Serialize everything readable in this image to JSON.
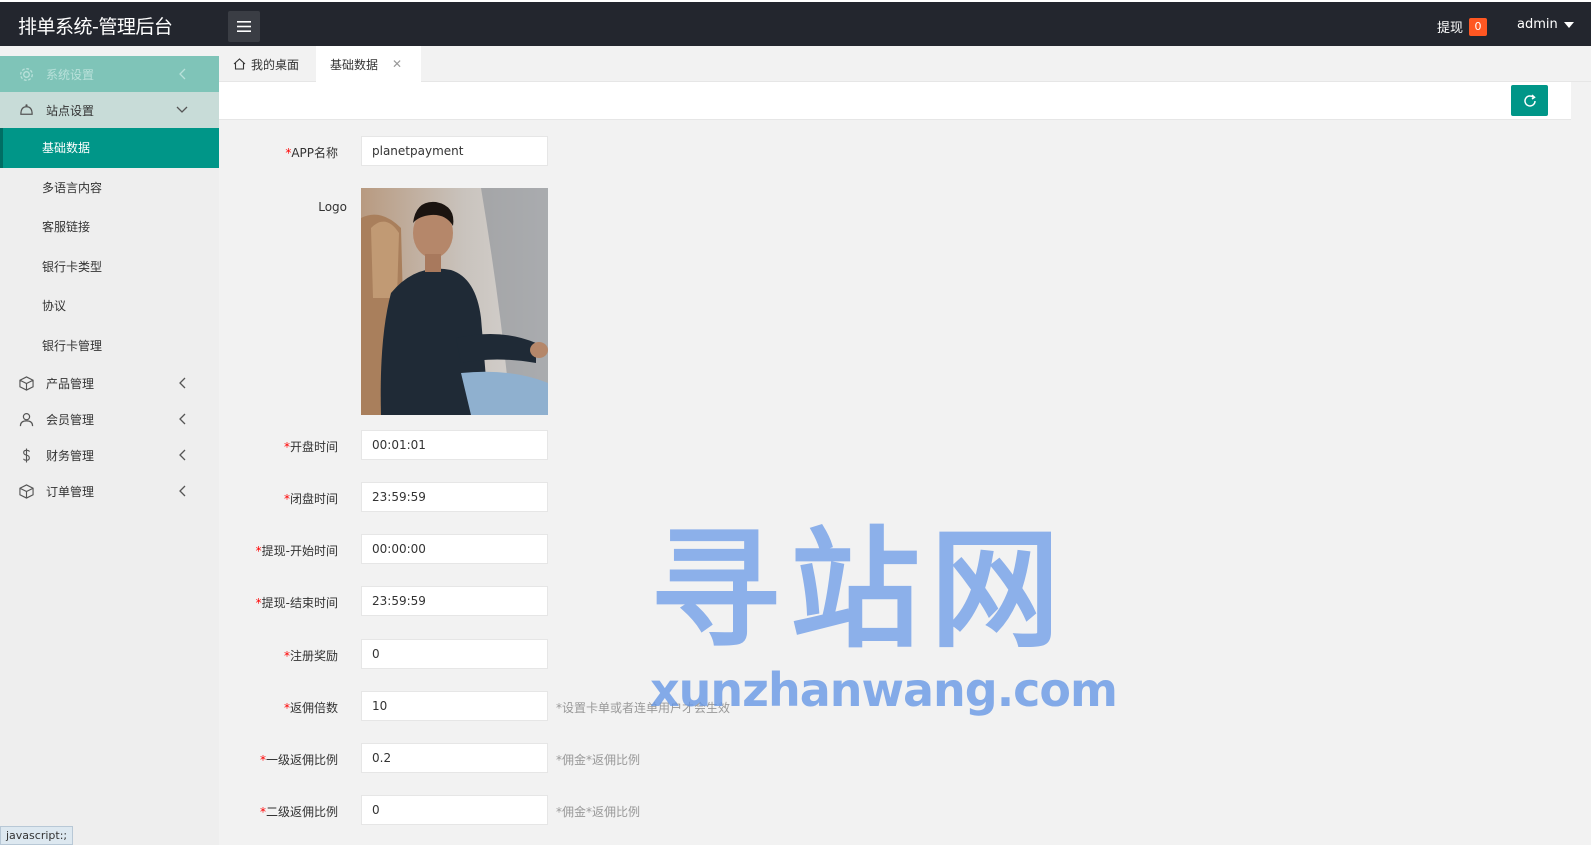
{
  "header": {
    "app_title": "排单系统-管理后台",
    "withdraw_label": "提现",
    "withdraw_count": "0",
    "user_name": "admin"
  },
  "sidebar": {
    "groups": [
      {
        "label": "系统设置",
        "icon": "gear-icon"
      },
      {
        "label": "站点设置",
        "icon": "site-icon"
      },
      {
        "label": "产品管理",
        "icon": "box-icon"
      },
      {
        "label": "会员管理",
        "icon": "user-icon"
      },
      {
        "label": "财务管理",
        "icon": "dollar-icon"
      },
      {
        "label": "订单管理",
        "icon": "box-icon"
      }
    ],
    "site_items": [
      "基础数据",
      "多语言内容",
      "客服链接",
      "银行卡类型",
      "协议",
      "银行卡管理"
    ]
  },
  "tabs": {
    "home": "我的桌面",
    "active": "基础数据"
  },
  "form": {
    "app_name": {
      "label": "APP名称",
      "value": "planetpayment"
    },
    "logo": {
      "label": "Logo"
    },
    "open_time": {
      "label": "开盘时间",
      "value": "00:01:01"
    },
    "close_time": {
      "label": "闭盘时间",
      "value": "23:59:59"
    },
    "withdraw_start": {
      "label": "提现-开始时间",
      "value": "00:00:00"
    },
    "withdraw_end": {
      "label": "提现-结束时间",
      "value": "23:59:59"
    },
    "register_reward": {
      "label": "注册奖励",
      "value": "0"
    },
    "commission_multiple": {
      "label": "返佣倍数",
      "value": "10",
      "hint": "*设置卡单或者连单用户才会生效"
    },
    "level1_ratio": {
      "label": "一级返佣比例",
      "value": "0.2",
      "hint": "*佣金*返佣比例"
    },
    "level2_ratio": {
      "label": "二级返佣比例",
      "value": "0",
      "hint": "*佣金*返佣比例"
    }
  },
  "watermark": {
    "cn": "寻站网",
    "en": "xunzhanwang.com"
  },
  "status_tip": "javascript:;",
  "colors": {
    "accent": "#009688",
    "topbar": "#23262e",
    "badge": "#ff5722",
    "required": "#ff0000"
  }
}
